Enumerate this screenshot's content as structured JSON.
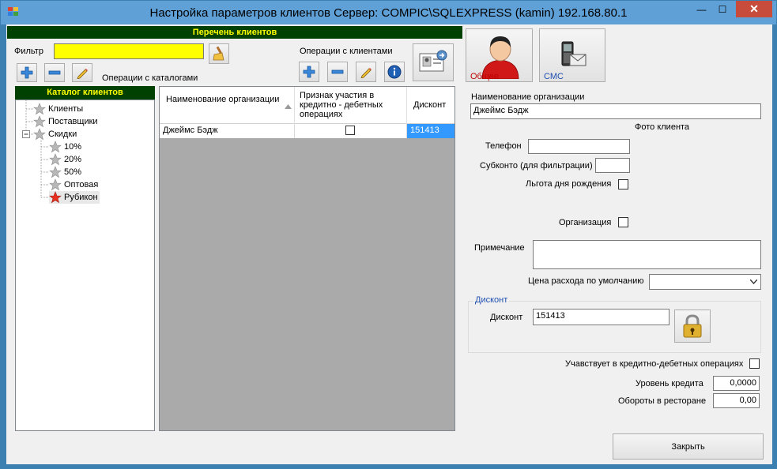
{
  "window": {
    "title": "Настройка параметров клиентов  Сервер: COMPIC\\SQLEXPRESS (kamin) 192.168.80.1",
    "minimize_glyph": "—",
    "maximize_glyph": "☐",
    "close_glyph": "✕"
  },
  "left": {
    "header": "Перечень клиентов",
    "filter_label": "Фильтр",
    "filter_value": "",
    "catalog_ops_label": "Операции с каталогами",
    "client_ops_label": "Операции с клиентами",
    "catalog_header": "Каталог клиентов",
    "tree": [
      {
        "label": "Клиенты"
      },
      {
        "label": "Поставщики"
      },
      {
        "label": "Скидки"
      },
      {
        "label": "10%"
      },
      {
        "label": "20%"
      },
      {
        "label": "50%"
      },
      {
        "label": "Оптовая"
      },
      {
        "label": "Рубикон"
      }
    ],
    "grid": {
      "columns": [
        "Наименование организации",
        "Признак участия в кредитно - дебетных операциях",
        "Дисконт"
      ],
      "rows": [
        {
          "name": "Джеймс Бэдж",
          "credit": false,
          "discount": "151413"
        }
      ]
    }
  },
  "right": {
    "tab_general": "Общее",
    "tab_sms": "СМС",
    "org_name_label": "Наименование организации",
    "org_name_value": "Джеймс Бэдж",
    "photo_label": "Фото клиента",
    "phone_label": "Телефон",
    "phone_value": "",
    "subconto_label": "Субконто (для фильтрации)",
    "subconto_value": "",
    "birthday_label": "Льгота дня рождения",
    "organization_label": "Организация",
    "note_label": "Примечание",
    "note_value": "",
    "price_label": "Цена расхода по умолчанию",
    "price_value": "",
    "discount_group": "Дисконт",
    "discount_label": "Дисконт",
    "discount_value": "151413",
    "credit_label": "Учавствует в кредитно-дебетных операциях",
    "credit_level_label": "Уровень кредита",
    "credit_level_value": "0,0000",
    "turnover_label": "Обороты в ресторане",
    "turnover_value": "0,00",
    "close_button": "Закрыть"
  },
  "colors": {
    "title_bar": "#5fa0d6",
    "green_header": "#004000",
    "header_text": "#ffff00",
    "filter_bg": "#ffff00",
    "selected_cell": "#3399ff",
    "close_red": "#c74c3c"
  }
}
